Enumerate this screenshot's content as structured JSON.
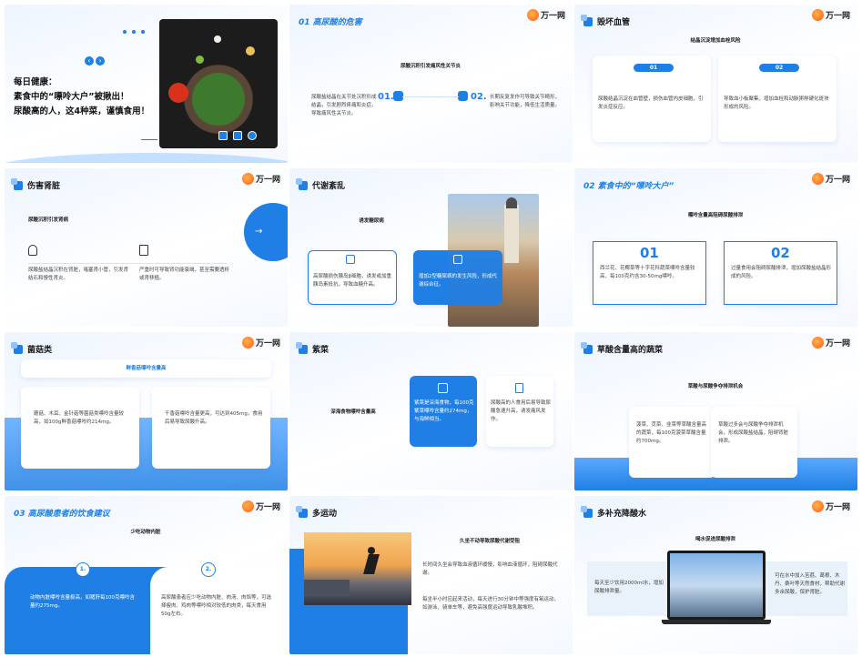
{
  "brand": {
    "name": "万一网"
  },
  "s1": {
    "title_lines": [
      "每日健康：",
      "素食中的“嘌呤大户”被揪出！",
      "尿酸高的人，这4种菜，谨慎食用！"
    ],
    "nav_prev": "‹",
    "nav_next": "›"
  },
  "s2": {
    "heading": "01 高尿酸的危害",
    "subtitle": "尿酸沉积引发痛风性关节炎",
    "left_text": "尿酸盐结晶在关节处沉积形成结晶，引发剧烈疼痛和炎症，导致痛风性关节炎。",
    "num1": "01.",
    "num2": "02.",
    "right_text": "长期反复发作可导致关节畸形，影响关节功能，降低生活质量。"
  },
  "s3": {
    "heading": "毁坏血管",
    "subtitle": "结晶沉淀增加血栓风险",
    "p1": "01",
    "p2": "02",
    "t1": "尿酸结晶沉淀在血管壁，损伤血管内皮细胞，引发炎症反应。",
    "t2": "导致血小板聚集，增加血栓和动脉粥样硬化斑块形成的风险。"
  },
  "s4": {
    "heading": "伤害肾脏",
    "subtitle": "尿酸沉积引发肾病",
    "t1": "尿酸盐结晶沉积在肾脏，堵塞肾小管，引发肾结石和慢性肾炎。",
    "t2": "严重时可导致肾功能衰竭，甚至需要透析或肾移植。",
    "arrow": "→"
  },
  "s5": {
    "heading": "代谢紊乱",
    "subtitle": "诱发糖尿病",
    "t1": "高尿酸损伤胰岛β细胞，诱发或加重胰岛素抵抗，导致血糖升高。",
    "t2": "增加2型糖尿病的发生风险，形成代谢综合征。"
  },
  "s6": {
    "heading": "02 素食中的“嘌呤大户”",
    "subtitle": "嘌呤含量高阻碍尿酸排泄",
    "n1": "01",
    "n2": "02",
    "t1": "西兰花、花椰菜等十字花科蔬菜嘌呤含量较高，每100克约含30-50mg嘌呤。",
    "t2": "过量食用会阻碍尿酸排泄，增加尿酸盐结晶形成的风险。"
  },
  "s7": {
    "heading": "菌菇类",
    "banner": "鲜香菇嘌呤含量高",
    "t1": "蘑菇、木耳、金针菇等菌菇类嘌呤含量较高，如100g鲜香菇嘌呤约214mg。",
    "t2": "干香菇嘌呤含量更高，可达到405mg，食用后易导致尿酸升高。"
  },
  "s8": {
    "heading": "紫菜",
    "subtitle": "深海食物嘌呤含量高",
    "t1": "紫菜是深海食物，每100克紫菜嘌呤含量约274mg，与海鲜相当。",
    "t2": "尿酸高的人食用后易导致尿酸急速升高，诱发痛风发作。"
  },
  "s9": {
    "heading": "草酸含量高的蔬菜",
    "subtitle": "草酸与尿酸争夺排泄机会",
    "t1": "菠菜、苋菜、韭菜等草酸含量高的蔬菜，每100克菠菜草酸含量约700mg。",
    "t2": "草酸过多会与尿酸争夺排泄机会，形成尿酸盐结晶，阻碍肾脏排泄。"
  },
  "s10": {
    "heading": "03 高尿酸患者的饮食建议",
    "subtitle": "少吃动物内脏",
    "n1": "1.",
    "n2": "2.",
    "t1": "动物内脏嘌呤含量极高，如猪肝每100克嘌呤含量约275mg。",
    "t2": "高尿酸患者应少吃动物内脏、肉汤、肉馅等，可选择瘦肉、鸡肉等嘌呤相对较低的肉类，每天食用50g左右。"
  },
  "s11": {
    "heading": "多运动",
    "subtitle": "久坐不动导致尿酸代谢受阻",
    "t1": "长时间久坐会导致血液循环缓慢，影响血液循环，阻碍尿酸代谢。",
    "t2": "每坐半小时应起来活动，每天进行30分钟中等强度有氧运动，如游泳、骑单车等，避免高强度运动导致乳酸堆积。"
  },
  "s12": {
    "heading": "多补充降酸水",
    "subtitle": "喝水促进尿酸排泄",
    "t1": "每天至少饮用2000ml水，增加尿酸排泄量。",
    "t2": "可在水中加入苦荔、葛根、木丹、桑叶等天然食材，帮助代谢多余尿酸，保护肾脏。"
  },
  "colors": {
    "accent": "#1f7fe5",
    "light": "#8fc3ff"
  }
}
